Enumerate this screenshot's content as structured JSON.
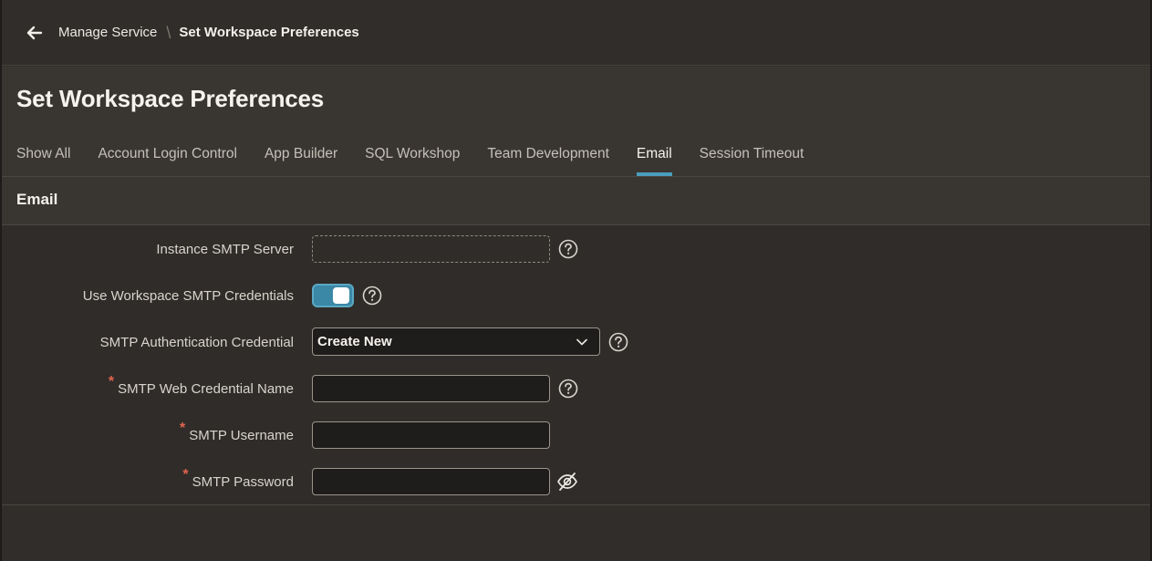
{
  "breadcrumb": {
    "back_icon": "arrow-left-icon",
    "parent": "Manage Service",
    "separator": "\\",
    "current": "Set Workspace Preferences"
  },
  "page": {
    "title": "Set Workspace Preferences"
  },
  "tabs": [
    {
      "label": "Show All",
      "active": false
    },
    {
      "label": "Account Login Control",
      "active": false
    },
    {
      "label": "App Builder",
      "active": false
    },
    {
      "label": "SQL Workshop",
      "active": false
    },
    {
      "label": "Team Development",
      "active": false
    },
    {
      "label": "Email",
      "active": true
    },
    {
      "label": "Session Timeout",
      "active": false
    }
  ],
  "region": {
    "title": "Email"
  },
  "form": {
    "instance_smtp_server": {
      "label": "Instance SMTP Server",
      "value": "",
      "help_icon": "help-circle-icon"
    },
    "use_workspace_smtp_credentials": {
      "label": "Use Workspace SMTP Credentials",
      "checked": true,
      "help_icon": "help-circle-icon"
    },
    "smtp_authentication_credential": {
      "label": "SMTP Authentication Credential",
      "selected": "Create New",
      "help_icon": "help-circle-icon"
    },
    "smtp_web_credential_name": {
      "label": "SMTP Web Credential Name",
      "required": "*",
      "value": "",
      "help_icon": "help-circle-icon"
    },
    "smtp_username": {
      "label": "SMTP Username",
      "required": "*",
      "value": ""
    },
    "smtp_password": {
      "label": "SMTP Password",
      "required": "*",
      "value": "",
      "reveal_icon": "eye-slash-icon"
    }
  },
  "colors": {
    "accent": "#4a9dbd",
    "required": "#e0644e",
    "toggle_on": "#3b88a6"
  }
}
